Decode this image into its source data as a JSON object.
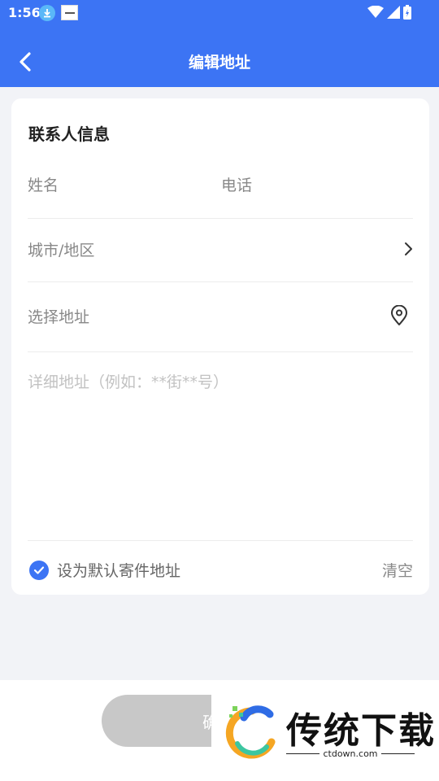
{
  "status_bar": {
    "time": "1:56"
  },
  "header": {
    "title": "编辑地址"
  },
  "form": {
    "section_title": "联系人信息",
    "name_placeholder": "姓名",
    "phone_placeholder": "电话",
    "city_label": "城市/地区",
    "select_address_label": "选择地址",
    "detail_placeholder": "详细地址（例如：**街**号）",
    "default_label": "设为默认寄件地址",
    "clear_label": "清空"
  },
  "footer": {
    "confirm_label": "确定"
  },
  "watermark": {
    "text": "传统下载",
    "url": "ctdown.com"
  },
  "colors": {
    "primary": "#3c74f4",
    "button_disabled": "#c8c8c8",
    "background": "#f2f3f7"
  }
}
